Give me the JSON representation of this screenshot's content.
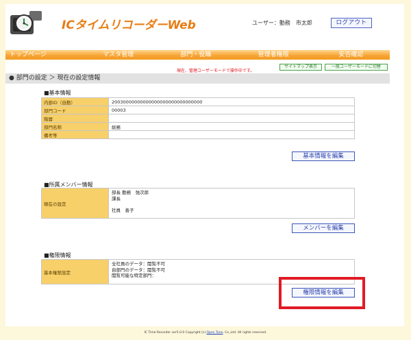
{
  "header": {
    "app_title": "ICタイムリコーダーWeb",
    "user_label": "ユーザー：動務　市太郎",
    "logout_label": "ログアウト"
  },
  "nav": {
    "items": [
      {
        "label": "トップページ"
      },
      {
        "label": "マスタ管理"
      },
      {
        "label": "部門・役職"
      },
      {
        "label": "管理者権限"
      },
      {
        "label": "安否確認"
      }
    ]
  },
  "notice": "現在、管理ユーザーモードで操作中です。",
  "toolbar": {
    "sitemap_label": "サイトマップ表示",
    "general_mode_label": "一般ユーザーモードに切替"
  },
  "breadcrumb": "● 部門の設定 ＞ 現在の設定情報",
  "basic_info": {
    "title": "■基本情報",
    "rows": [
      {
        "label": "内部ID（自動）",
        "value": "20030000000000000000000000000000"
      },
      {
        "label": "部門コード",
        "value": "00003"
      },
      {
        "label": "階層",
        "value": ""
      },
      {
        "label": "部門名称",
        "value": "総務"
      },
      {
        "label": "備考等",
        "value": ""
      }
    ],
    "edit_label": "基本情報を編集"
  },
  "members": {
    "title": "■所属メンバー情報",
    "label": "現在の設定",
    "lines": [
      "部長 動務　強次郎",
      "課長",
      "",
      "社員　善子"
    ],
    "edit_label": "メンバーを編集"
  },
  "permissions": {
    "title": "■権限情報",
    "label": "基本権限設定",
    "lines": [
      "全社員のデータ：閲覧不可",
      "自部門のデータ：閲覧不可",
      "閲覧可能な特定部門："
    ],
    "edit_label": "権限情報を編集"
  },
  "footer": {
    "prefix": "IC Time Recorder ver5.0.0 Copyright (c) ",
    "link": "Open Tone",
    "suffix": ", Co.,Ltd. All rights reserved."
  },
  "colors": {
    "accent": "#f29b20",
    "highlight": "#e01b24",
    "label_bg": "#f7d06a",
    "background": "#fdf8dc"
  }
}
